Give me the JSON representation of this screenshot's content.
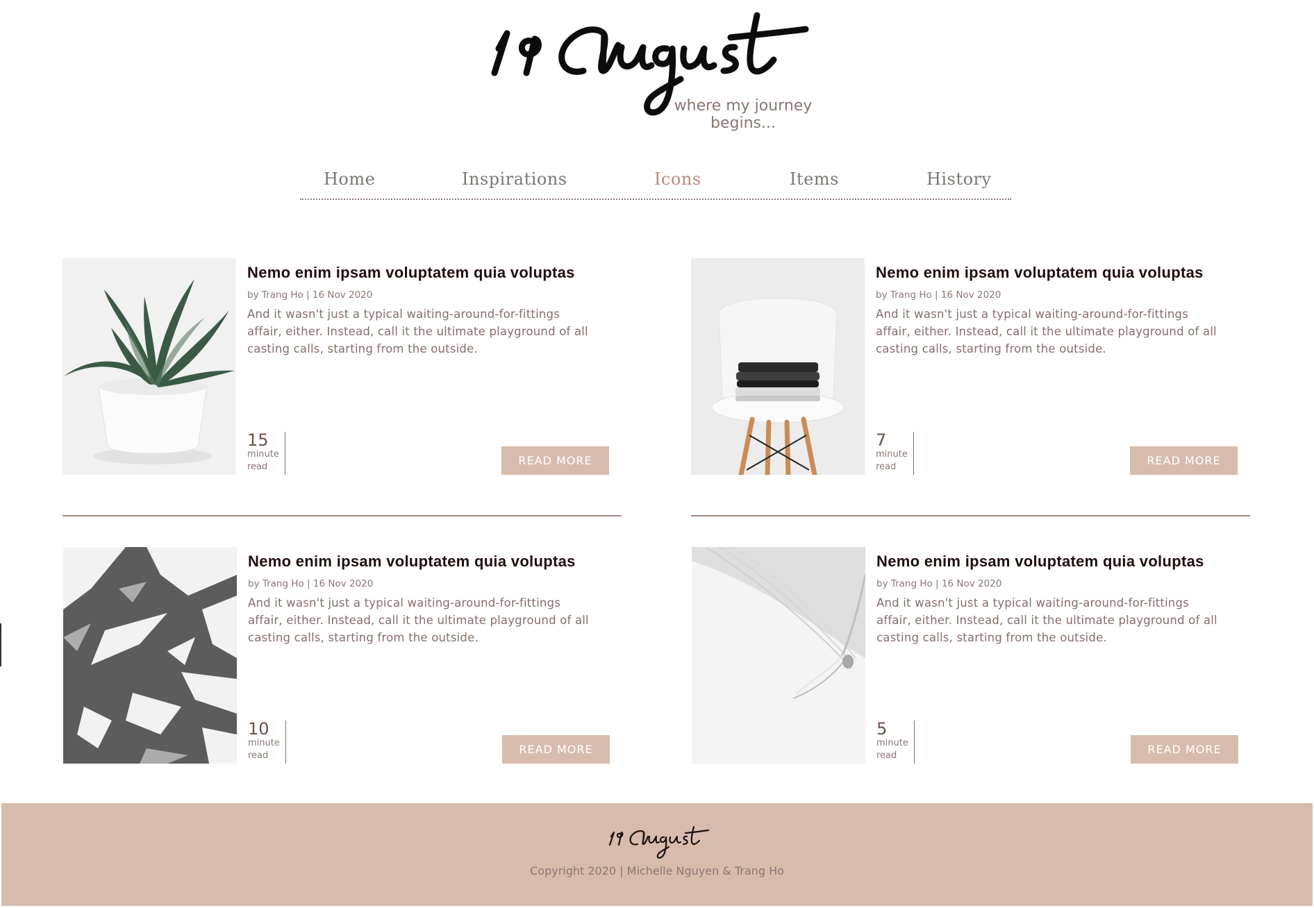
{
  "brand": {
    "logo_text": "19 August",
    "tagline_line1": "where my journey",
    "tagline_line2": "begins..."
  },
  "nav": {
    "items": [
      {
        "label": "Home"
      },
      {
        "label": "Inspirations"
      },
      {
        "label": "Icons",
        "active": true
      },
      {
        "label": "Items"
      },
      {
        "label": "History"
      }
    ]
  },
  "posts": [
    {
      "title": "Nemo enim ipsam voluptatem quia voluptas",
      "meta": "by Trang Ho | 16 Nov 2020",
      "excerpt": "And it wasn't just a typical waiting-around-for-fittings affair, either. Instead, call it the ultimate playground of all casting calls, starting from the outside.",
      "read_num": "15",
      "read_unit1": "minute",
      "read_unit2": "read",
      "button": "READ MORE",
      "image": "potted-plant"
    },
    {
      "title": "Nemo enim ipsam voluptatem quia voluptas",
      "meta": "by Trang Ho | 16 Nov 2020",
      "excerpt": "And it wasn't just a typical waiting-around-for-fittings affair, either. Instead, call it the ultimate playground of all casting calls, starting from the outside.",
      "read_num": "7",
      "read_unit1": "minute",
      "read_unit2": "read",
      "button": "READ MORE",
      "image": "chair-with-clothes"
    },
    {
      "title": "Nemo enim ipsam voluptatem quia voluptas",
      "meta": "by Trang Ho | 16 Nov 2020",
      "excerpt": "And it wasn't just a typical waiting-around-for-fittings affair, either. Instead, call it the ultimate playground of all casting calls, starting from the outside.",
      "read_num": "10",
      "read_unit1": "minute",
      "read_unit2": "read",
      "button": "READ MORE",
      "image": "palm-shadow"
    },
    {
      "title": "Nemo enim ipsam voluptatem quia voluptas",
      "meta": "by Trang Ho | 16 Nov 2020",
      "excerpt": "And it wasn't just a typical waiting-around-for-fittings affair, either. Instead, call it the ultimate playground of all casting calls, starting from the outside.",
      "read_num": "5",
      "read_unit1": "minute",
      "read_unit2": "read",
      "button": "READ MORE",
      "image": "open-book"
    }
  ],
  "footer": {
    "logo_text": "19 August",
    "copyright": "Copyright 2020 | Michelle Nguyen & Trang Ho"
  },
  "colors": {
    "accent": "#d7bcad",
    "nav_active": "#b98b7a",
    "title": "#1f0e0c",
    "body_text": "#866e69"
  }
}
